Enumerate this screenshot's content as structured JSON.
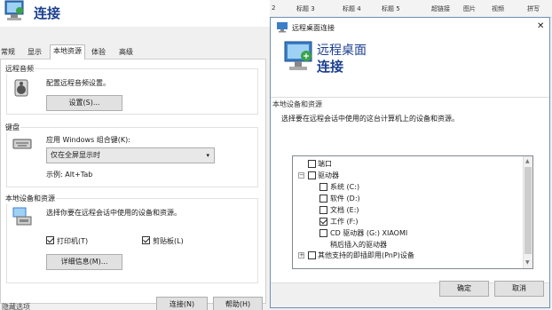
{
  "left": {
    "title": "连接",
    "tabs": [
      "常规",
      "显示",
      "本地资源",
      "体验",
      "高级"
    ],
    "audio": {
      "group": "远程音频",
      "desc": "配置远程音频设置。",
      "button": "设置(S)..."
    },
    "keyboard": {
      "group": "键盘",
      "label": "应用 Windows 组合键(K):",
      "value": "仅在全屏显示时",
      "example": "示例: Alt+Tab"
    },
    "local": {
      "group": "本地设备和资源",
      "desc": "选择你要在远程会话中使用的设备和资源。",
      "printer": "打印机(T)",
      "clipboard": "剪贴板(L)",
      "details_button": "详细信息(M)..."
    },
    "bottom_text": "隐藏选项",
    "connect_button": "连接(N)",
    "help_button": "帮助(H)"
  },
  "toolbar": {
    "items": [
      "2",
      "标题 3",
      "标题 4",
      "标题 5",
      "超链接",
      "图片",
      "视频",
      "拼写"
    ]
  },
  "dialog": {
    "window_title": "远程桌面连接",
    "close_glyph": "✕",
    "heading1": "远程桌面",
    "heading2": "连接",
    "group": "本地设备和资源",
    "desc": "选择要在远程会话中使用的这台计算机上的设备和资源。",
    "tree": {
      "port": "端口",
      "drives": "驱动器",
      "system": "系统 (C:)",
      "software": "软件 (D:)",
      "docs": "文档 (E:)",
      "work": "工作 (F:)",
      "cd": "CD 驱动器 (G:) XIAOMI",
      "later": "稍后插入的驱动器",
      "pnp": "其他支持的即插即用(PnP)设备"
    },
    "ok_button": "确定",
    "cancel_button": "取消"
  }
}
